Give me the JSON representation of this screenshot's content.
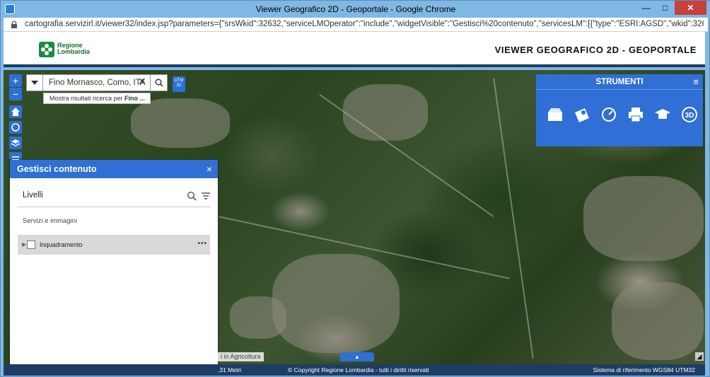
{
  "window": {
    "title": "Viewer Geografico 2D - Geoportale - Google Chrome"
  },
  "address": {
    "url": "cartografia.servizirl.it/viewer32/index.jsp?parameters={\"srsWkid\":32632,\"serviceLMOperator\":\"include\",\"widgetVisible\":\"Gestisci%20contenuto\",\"servicesLM\":[{\"type\":\"ESRI:AGSD\",\"wkid\":32632,\"queryAndZoom\":..."
  },
  "header": {
    "logo_line1": "Regione",
    "logo_line2": "Lombardia",
    "app_title": "VIEWER GEOGRAFICO 2D - GEOPORTALE"
  },
  "map_controls": {
    "zoom_in": "+",
    "zoom_out": "−",
    "utm_label": "UTM 32"
  },
  "search": {
    "value": "Fino Mornasco, Como, ITA",
    "hint_prefix": "Mostra risultati ricerca per ",
    "hint_term": "Fino ..."
  },
  "panel": {
    "title": "Gestisci contenuto",
    "close": "×",
    "levels_label": "Livelli",
    "section_label": "Servizi e immagini",
    "layers": [
      {
        "label": "Inquadramento",
        "checked": false
      }
    ]
  },
  "strumenti": {
    "title": "STRUMENTI",
    "menu": "≡",
    "tools": [
      "box-icon",
      "map-marker-icon",
      "measure-icon",
      "print-icon",
      "education-icon",
      "3d-icon"
    ],
    "tool_3d_label": "3D"
  },
  "map_overlay": {
    "agricoltura": "i in Agricoltura"
  },
  "status": {
    "scale": ",31 Metri",
    "copyright": "© Copyright Regione Lombardia - tutti i diritti riservati",
    "reference": "Sistema di riferimento WGS84 UTM32"
  },
  "colors": {
    "accent": "#2f6fd6",
    "status_bg": "#1f3d63",
    "titlebar": "#7fb8e3"
  }
}
